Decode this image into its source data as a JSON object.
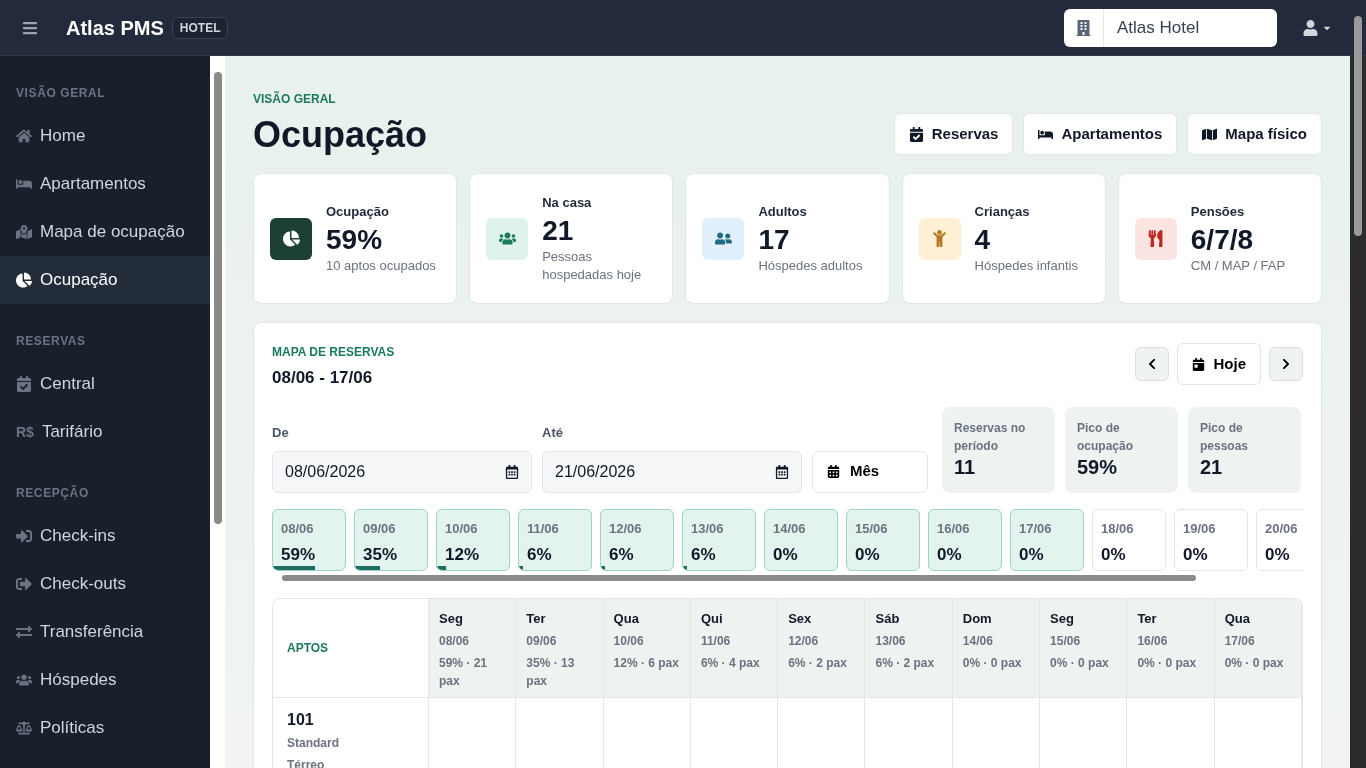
{
  "header": {
    "brand": "Atlas PMS",
    "badge": "HOTEL",
    "hotel": "Atlas Hotel"
  },
  "sidebar": {
    "sections": [
      {
        "title": "VISÃO GERAL",
        "items": [
          {
            "label": "Home",
            "selected": false
          },
          {
            "label": "Apartamentos",
            "selected": false
          },
          {
            "label": "Mapa de ocupação",
            "selected": false
          },
          {
            "label": "Ocupação",
            "selected": true
          }
        ]
      },
      {
        "title": "RESERVAS",
        "items": [
          {
            "label": "Central",
            "selected": false
          },
          {
            "label": "Tarifário",
            "glyph": "R$",
            "selected": false
          }
        ]
      },
      {
        "title": "RECEPÇÃO",
        "items": [
          {
            "label": "Check-ins",
            "selected": false
          },
          {
            "label": "Check-outs",
            "selected": false
          },
          {
            "label": "Transferência",
            "selected": false
          },
          {
            "label": "Hóspedes",
            "selected": false
          },
          {
            "label": "Políticas",
            "selected": false
          }
        ]
      }
    ]
  },
  "page": {
    "eyebrow": "VISÃO GERAL",
    "title": "Ocupação",
    "actions": [
      "Reservas",
      "Apartamentos",
      "Mapa físico"
    ]
  },
  "stats": [
    {
      "label": "Ocupação",
      "value": "59%",
      "sub": "10 aptos ocupados"
    },
    {
      "label": "Na casa",
      "value": "21",
      "sub": "Pessoas hospedadas hoje"
    },
    {
      "label": "Adultos",
      "value": "17",
      "sub": "Hóspedes adultos"
    },
    {
      "label": "Crianças",
      "value": "4",
      "sub": "Hóspedes infantis"
    },
    {
      "label": "Pensões",
      "value": "6/7/8",
      "sub": "CM / MAP / FAP"
    }
  ],
  "map": {
    "eyebrow": "MAPA DE RESERVAS",
    "range": "08/06 - 17/06",
    "today": "Hoje",
    "from": {
      "label": "De",
      "value": "08/06/2026"
    },
    "to": {
      "label": "Até",
      "value": "21/06/2026"
    },
    "mode": "Mês",
    "summary": [
      {
        "label": "Reservas no período",
        "value": "11"
      },
      {
        "label": "Pico de ocupação",
        "value": "59%"
      },
      {
        "label": "Pico de pessoas",
        "value": "21"
      }
    ],
    "days": [
      {
        "date": "08/06",
        "pct": "59%",
        "level": 0.59,
        "in_period": true
      },
      {
        "date": "09/06",
        "pct": "35%",
        "level": 0.35,
        "in_period": true
      },
      {
        "date": "10/06",
        "pct": "12%",
        "level": 0.12,
        "in_period": true
      },
      {
        "date": "11/06",
        "pct": "6%",
        "level": 0.06,
        "in_period": true
      },
      {
        "date": "12/06",
        "pct": "6%",
        "level": 0.06,
        "in_period": true
      },
      {
        "date": "13/06",
        "pct": "6%",
        "level": 0.06,
        "in_period": true
      },
      {
        "date": "14/06",
        "pct": "0%",
        "level": 0,
        "in_period": true
      },
      {
        "date": "15/06",
        "pct": "0%",
        "level": 0,
        "in_period": true
      },
      {
        "date": "16/06",
        "pct": "0%",
        "level": 0,
        "in_period": true
      },
      {
        "date": "17/06",
        "pct": "0%",
        "level": 0,
        "in_period": true
      },
      {
        "date": "18/06",
        "pct": "0%",
        "level": 0,
        "in_period": false
      },
      {
        "date": "19/06",
        "pct": "0%",
        "level": 0,
        "in_period": false
      },
      {
        "date": "20/06",
        "pct": "0%",
        "level": 0,
        "in_period": false
      }
    ]
  },
  "grid": {
    "corner": "APTOS",
    "columns": [
      {
        "day": "Seg",
        "date": "08/06",
        "stat": "59% · 21 pax"
      },
      {
        "day": "Ter",
        "date": "09/06",
        "stat": "35% · 13 pax"
      },
      {
        "day": "Qua",
        "date": "10/06",
        "stat": "12% · 6 pax"
      },
      {
        "day": "Qui",
        "date": "11/06",
        "stat": "6% · 4 pax"
      },
      {
        "day": "Sex",
        "date": "12/06",
        "stat": "6% · 2 pax"
      },
      {
        "day": "Sáb",
        "date": "13/06",
        "stat": "6% · 2 pax"
      },
      {
        "day": "Dom",
        "date": "14/06",
        "stat": "0% · 0 pax"
      },
      {
        "day": "Seg",
        "date": "15/06",
        "stat": "0% · 0 pax"
      },
      {
        "day": "Ter",
        "date": "16/06",
        "stat": "0% · 0 pax"
      },
      {
        "day": "Qua",
        "date": "17/06",
        "stat": "0% · 0 pax"
      }
    ],
    "rows": [
      {
        "number": "101",
        "type": "Standard",
        "floor": "Térreo"
      }
    ]
  }
}
